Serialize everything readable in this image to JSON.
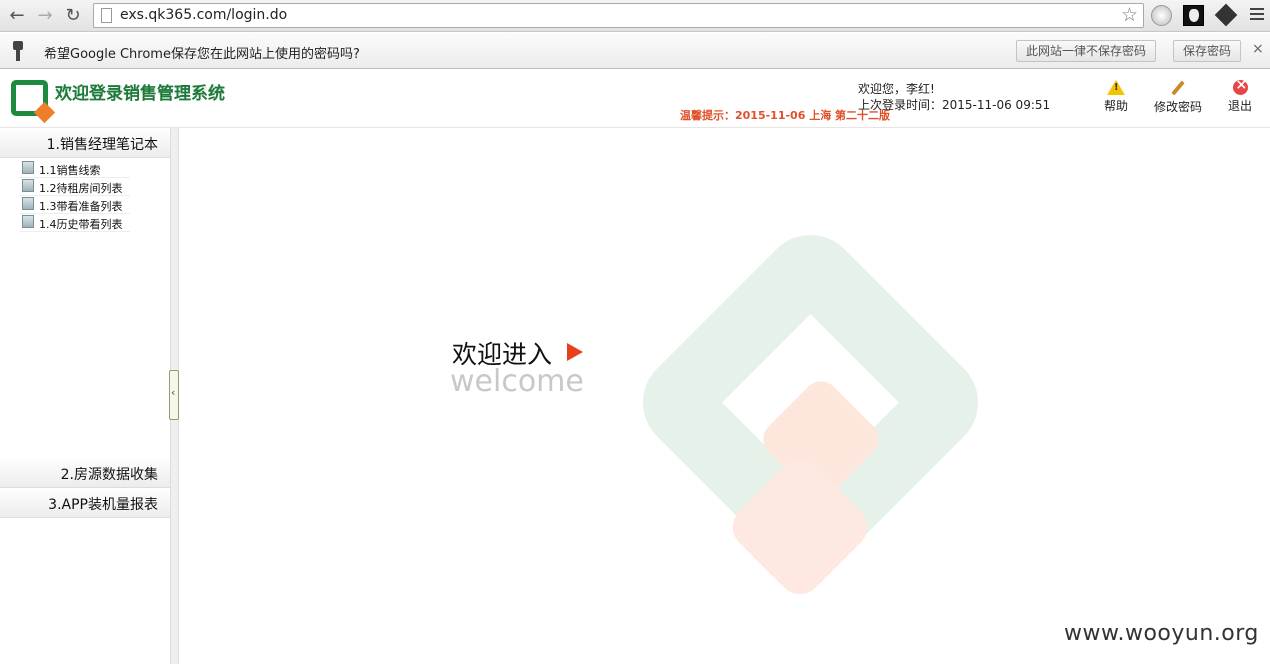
{
  "browser": {
    "url": "exs.qk365.com/login.do",
    "infobar": {
      "message": "希望Google Chrome保存您在此网站上使用的密码吗?",
      "never_label": "此网站一律不保存密码",
      "save_label": "保存密码",
      "close_glyph": "×"
    }
  },
  "header": {
    "title": "欢迎登录销售管理系统",
    "welcome_user": "欢迎您，李红!",
    "last_login": "上次登录时间：2015-11-06 09:51",
    "tip": "温馨提示：2015-11-06 上海 第二十二版",
    "buttons": {
      "help": "帮助",
      "change_password": "修改密码",
      "logout": "退出"
    }
  },
  "sidebar": {
    "sections": [
      {
        "label": "1.销售经理笔记本",
        "items": [
          "1.1销售线索",
          "1.2待租房间列表",
          "1.3带看准备列表",
          "1.4历史带看列表"
        ]
      },
      {
        "label": "2.房源数据收集"
      },
      {
        "label": "3.APP装机量报表"
      }
    ]
  },
  "main": {
    "enter_text": "欢迎进入",
    "welcome_en": "welcome"
  },
  "watermark": "www.wooyun.org",
  "colors": {
    "brand_green": "#1e8a3e",
    "brand_orange": "#f07d2a",
    "tip_red": "#e0502a",
    "arrow_red": "#e8401a"
  }
}
